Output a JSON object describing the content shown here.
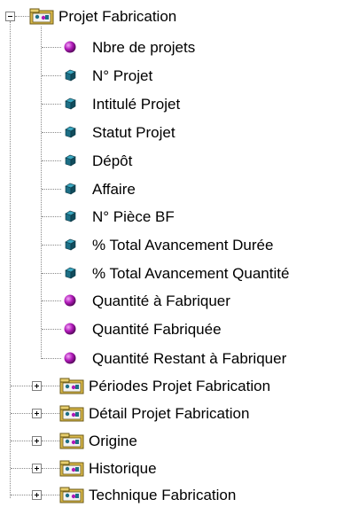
{
  "tree": {
    "root": {
      "label": "Projet Fabrication",
      "icon": "class-folder-icon",
      "expanded": true
    },
    "children": [
      {
        "label": "Nbre de projets",
        "type": "measure",
        "icon": "measure-sphere-icon"
      },
      {
        "label": "N° Projet",
        "type": "dimension",
        "icon": "dimension-cube-icon"
      },
      {
        "label": "Intitulé Projet",
        "type": "dimension",
        "icon": "dimension-cube-icon"
      },
      {
        "label": "Statut Projet",
        "type": "dimension",
        "icon": "dimension-cube-icon"
      },
      {
        "label": "Dépôt",
        "type": "dimension",
        "icon": "dimension-cube-icon"
      },
      {
        "label": "Affaire",
        "type": "dimension",
        "icon": "dimension-cube-icon"
      },
      {
        "label": "N° Pièce BF",
        "type": "dimension",
        "icon": "dimension-cube-icon"
      },
      {
        "label": "% Total Avancement Durée",
        "type": "dimension",
        "icon": "dimension-cube-icon"
      },
      {
        "label": "% Total Avancement Quantité",
        "type": "dimension",
        "icon": "dimension-cube-icon"
      },
      {
        "label": "Quantité à Fabriquer",
        "type": "measure",
        "icon": "measure-sphere-icon"
      },
      {
        "label": "Quantité Fabriquée",
        "type": "measure",
        "icon": "measure-sphere-icon"
      },
      {
        "label": "Quantité Restant à Fabriquer",
        "type": "measure",
        "icon": "measure-sphere-icon"
      }
    ],
    "subclasses": [
      {
        "label": "Périodes Projet Fabrication",
        "icon": "class-folder-icon",
        "expanded": false
      },
      {
        "label": "Détail Projet Fabrication",
        "icon": "class-folder-icon",
        "expanded": false
      },
      {
        "label": "Origine",
        "icon": "class-folder-icon",
        "expanded": false
      },
      {
        "label": "Historique",
        "icon": "class-folder-icon",
        "expanded": false
      },
      {
        "label": "Technique Fabrication",
        "icon": "class-folder-icon",
        "expanded": false
      }
    ]
  },
  "colors": {
    "measure": "#b01ab8",
    "dimension_front": "#1d6f86",
    "dimension_top": "#3aa7c0",
    "folder": "#d9b84a",
    "connector": "#8a8a8a"
  }
}
